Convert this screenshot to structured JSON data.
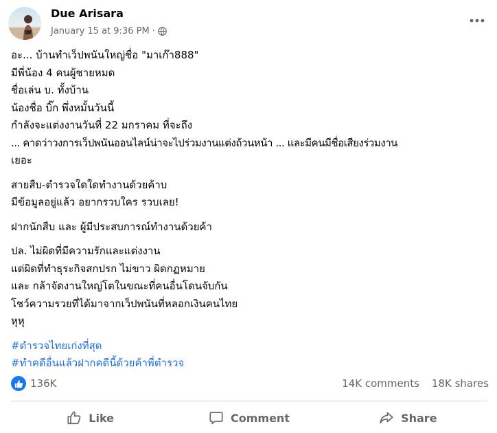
{
  "post": {
    "author": "Due Arisara",
    "timestamp": "January 15 at 9:36 PM",
    "separator": "·",
    "privacy_icon": "globe-icon",
    "menu_icon": "more-options-icon",
    "lines": [
      "อะ... บ้านทำเว็ปพนันใหญ่ชื่อ \"มาเก๊า888\"",
      "มีพี่น้อง 4 คนผู้ชายหมด",
      "ชื่อเล่น บ. ทั้งบ้าน",
      "น้องชื่อ บิ๊ก พึ่งหมั้นวันนี้",
      "กำลังจะแต่งงานวันที่ 22 มกราคม ที่จะถึง",
      "... คาดว่าวงการเว็ปพนันออนไลน์น่าจะไปร่วมงานแต่งถ้วนหน้า ... และมีคนมีชื่อเสียงร่วมงาน",
      "เยอะ",
      "สายสืบ-ตำรวจใดใดทำงานด้วยค้าบ",
      "มีข้อมูลอยู่แล้ว อยากรวบใคร รวบเลย!",
      "ฝากนักสืบ และ ผู้มีประสบการณ์ทำงานด้วยค้า",
      "ปล. ไม่ผิดที่มีความรักและแต่งงาน",
      "แต่ผิดที่ทำธุระกิจสกปรก ไม่ขาว ผิดกฏหมาย",
      "และ กล้าจัดงานใหญ่โตในขณะที่คนอื่นโดนจับกัน",
      "โชว์ความรวยที่ได้มาจากเว็ปพนันที่หลอกเงินคนไทย",
      "หุหุ"
    ],
    "hashtags": [
      "#ตำรวจไทยเก่งที่สุด",
      "#ทำคดีอื่นแล้วฝากคดีนี้ด้วยค้าพี่ตำรวจ"
    ]
  },
  "stats": {
    "reaction_icon": "like-reaction-icon",
    "reactions": "136K",
    "comments": "14K comments",
    "shares": "18K shares"
  },
  "actions": {
    "like": "Like",
    "comment": "Comment",
    "share": "Share"
  },
  "colors": {
    "accent": "#1877f2",
    "hashtag": "#216fdb",
    "secondary_text": "#65676b",
    "divider": "#ced0d4"
  }
}
